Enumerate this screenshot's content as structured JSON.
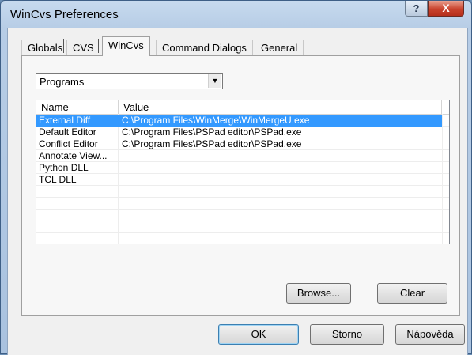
{
  "window": {
    "title": "WinCvs Preferences",
    "help_label": "?",
    "close_label": "X"
  },
  "tabs": [
    {
      "label": "Globals",
      "active": false
    },
    {
      "label": "CVS",
      "active": false
    },
    {
      "label": "WinCvs",
      "active": true
    },
    {
      "label": "Command Dialogs",
      "active": false
    },
    {
      "label": "General",
      "active": false
    }
  ],
  "combo": {
    "value": "Programs",
    "arrow": "▼"
  },
  "list": {
    "columns": [
      "Name",
      "Value"
    ],
    "rows": [
      {
        "name": "External Diff",
        "value": "C:\\Program Files\\WinMerge\\WinMergeU.exe",
        "selected": true
      },
      {
        "name": "Default Editor",
        "value": "C:\\Program Files\\PSPad editor\\PSPad.exe",
        "selected": false
      },
      {
        "name": "Conflict Editor",
        "value": "C:\\Program Files\\PSPad editor\\PSPad.exe",
        "selected": false
      },
      {
        "name": "Annotate View...",
        "value": "",
        "selected": false
      },
      {
        "name": "Python DLL",
        "value": "",
        "selected": false
      },
      {
        "name": "TCL DLL",
        "value": "",
        "selected": false
      }
    ]
  },
  "buttons": {
    "browse": "Browse...",
    "clear": "Clear",
    "ok": "OK",
    "storno": "Storno",
    "napoveda": "Nápověda"
  },
  "colors": {
    "selection": "#3399ff",
    "close_button": "#c9432d"
  }
}
